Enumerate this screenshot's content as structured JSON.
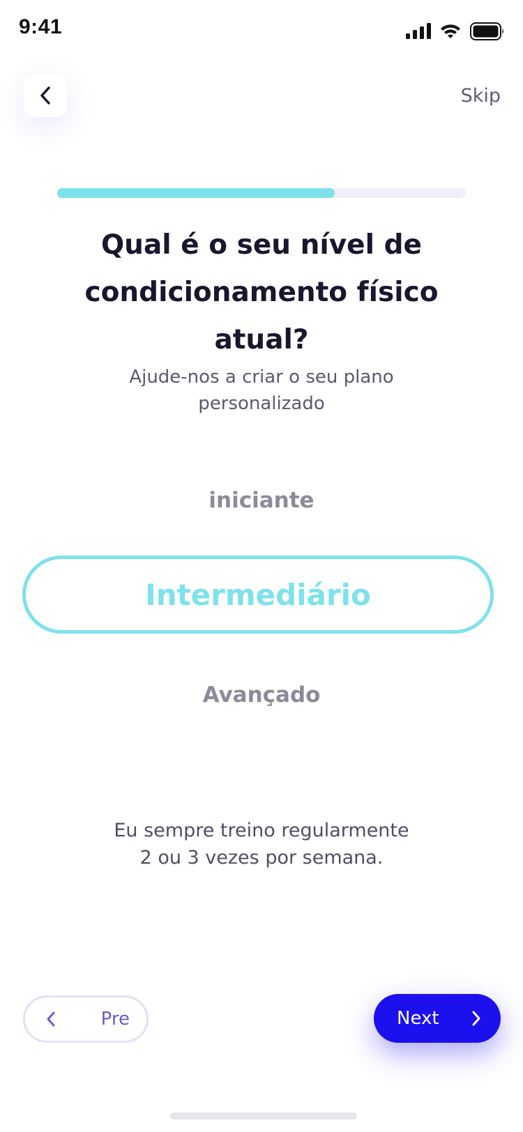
{
  "status_bar": {
    "time": "9:41"
  },
  "header": {
    "back_icon": "chevron-left-icon",
    "skip_label": "Skip"
  },
  "progress": {
    "value": 0.68,
    "fill_color": "#7de2ec",
    "track_color": "#f0eff7"
  },
  "question": {
    "title": "Qual é o seu nível de condicionamento físico atual?",
    "subtitle": "Ajude-nos a criar o seu plano personalizado"
  },
  "options": {
    "items": [
      {
        "label": "iniciante",
        "selected": false
      },
      {
        "label": "Intermediário",
        "selected": true
      },
      {
        "label": "Avançado",
        "selected": false
      }
    ],
    "selected_color": "#7de2ec"
  },
  "description": {
    "line1": "Eu sempre treino regularmente",
    "line2": "2 ou 3 vezes por semana."
  },
  "footer": {
    "prev_label": "Pre",
    "prev_icon": "chevron-left-icon",
    "next_label": "Next",
    "next_icon": "chevron-right-icon",
    "next_color": "#1d10ee"
  }
}
